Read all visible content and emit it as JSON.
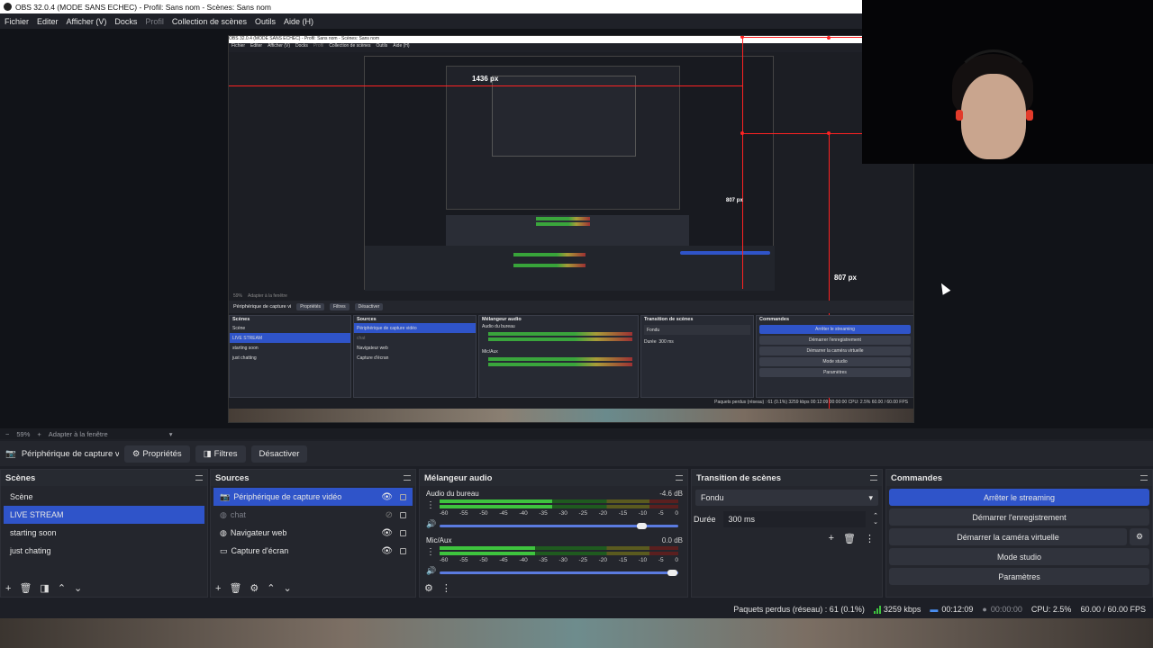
{
  "window": {
    "title": "OBS 32.0.4 (MODE SANS ECHEC) - Profil: Sans nom - Scènes: Sans nom"
  },
  "menu": [
    {
      "label": "Fichier",
      "disabled": false
    },
    {
      "label": "Editer",
      "disabled": false
    },
    {
      "label": "Afficher (V)",
      "disabled": false
    },
    {
      "label": "Docks",
      "disabled": false
    },
    {
      "label": "Profil",
      "disabled": true
    },
    {
      "label": "Collection de scènes",
      "disabled": false
    },
    {
      "label": "Outils",
      "disabled": false
    },
    {
      "label": "Aide (H)",
      "disabled": false
    }
  ],
  "preview": {
    "nested_title": "OBS 32.0.4 (MODE SANS ECHEC) - Profil: Sans nom - Scènes: Sans nom",
    "nested_menu": [
      "Fichier",
      "Editer",
      "Afficher (V)",
      "Docks",
      "Profil",
      "Collection de scènes",
      "Outils",
      "Aide (H)"
    ],
    "measure_width": "1436 px",
    "measure_height": "807 px",
    "measure_height_small": "807 px",
    "nested_zoom": "59%",
    "nested_fit": "Adapter à la fenêtre",
    "nested_source_name": "Périphérique de capture vi",
    "nested_props": "Propriétés",
    "nested_filters": "Filtres",
    "nested_disable": "Désactiver",
    "nested_scenes_title": "Scènes",
    "nested_scenes": [
      "Scène",
      "LIVE STREAM",
      "starting soon",
      "just chatting"
    ],
    "nested_sources_title": "Sources",
    "nested_sources": [
      "Périphérique de capture vidéo",
      "chat",
      "Navigateur web",
      "Capture d'écran"
    ],
    "nested_mixer_title": "Mélangeur audio",
    "nested_mixer_ch1": "Audio du bureau",
    "nested_mixer_ch2": "Mic/Aux",
    "nested_transition_title": "Transition de scènes",
    "nested_transition": "Fondu",
    "nested_duration_label": "Durée",
    "nested_duration": "300 ms",
    "nested_commands_title": "Commandes",
    "nested_commands": [
      "Arrêter le streaming",
      "Démarrer l'enregistrement",
      "Démarrer la caméra virtuelle",
      "Mode studio",
      "Paramètres"
    ],
    "nested_status": "Paquets perdus (réseau) : 61 (0.1%)   3259 kbps   00:12:09   00:00:00   CPU: 2.5%   60.00 / 60.00 FPS"
  },
  "zoom": {
    "minus": "−",
    "value": "59%",
    "plus": "+",
    "fit": "Adapter à la fenêtre"
  },
  "source_toolbar": {
    "source_name": "Périphérique de capture vic",
    "properties": "Propriétés",
    "filters": "Filtres",
    "disable": "Désactiver"
  },
  "scenes": {
    "title": "Scènes",
    "items": [
      {
        "label": "Scène",
        "selected": false
      },
      {
        "label": "LIVE STREAM",
        "selected": true
      },
      {
        "label": "starting soon",
        "selected": false
      },
      {
        "label": "just chating",
        "selected": false
      }
    ]
  },
  "sources": {
    "title": "Sources",
    "items": [
      {
        "label": "Périphérique de capture vidéo",
        "icon": "camera-icon",
        "selected": true,
        "visible": true
      },
      {
        "label": "chat",
        "icon": "globe-icon",
        "selected": false,
        "visible": false
      },
      {
        "label": "Navigateur web",
        "icon": "globe-icon",
        "selected": false,
        "visible": true
      },
      {
        "label": "Capture d'écran",
        "icon": "monitor-icon",
        "selected": false,
        "visible": true
      }
    ]
  },
  "mixer": {
    "title": "Mélangeur audio",
    "channels": [
      {
        "name": "Audio du bureau",
        "db": "-4.6 dB",
        "level": 0.47,
        "volume": 0.87
      },
      {
        "name": "Mic/Aux",
        "db": "0.0 dB",
        "level": 0.4,
        "volume": 1.0
      }
    ],
    "ticks": [
      "-60",
      "-55",
      "-50",
      "-45",
      "-40",
      "-35",
      "-30",
      "-25",
      "-20",
      "-15",
      "-10",
      "-5",
      "0"
    ]
  },
  "transition": {
    "title": "Transition de scènes",
    "type": "Fondu",
    "duration_label": "Durée",
    "duration": "300 ms"
  },
  "commands": {
    "title": "Commandes",
    "stop_streaming": "Arrêter le streaming",
    "start_recording": "Démarrer l'enregistrement",
    "start_virtualcam": "Démarrer la caméra virtuelle",
    "studio_mode": "Mode studio",
    "settings": "Paramètres"
  },
  "status": {
    "dropped": "Paquets perdus (réseau) : 61 (0.1%)",
    "bitrate": "3259 kbps",
    "stream_time": "00:12:09",
    "record_time": "00:00:00",
    "cpu": "CPU: 2.5%",
    "fps": "60.00 / 60.00 FPS"
  },
  "colors": {
    "accent": "#2f54c9",
    "measure": "#ff2222",
    "meter_green": "#3ec43e"
  }
}
